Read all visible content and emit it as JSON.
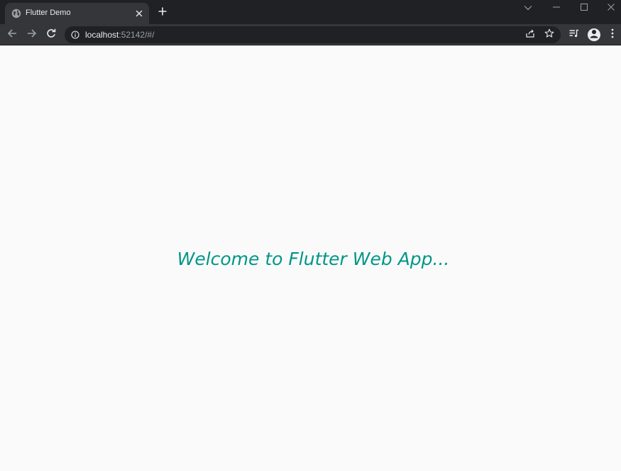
{
  "browser": {
    "tab": {
      "title": "Flutter Demo",
      "favicon_icon": "globe-icon",
      "close_icon": "close-icon"
    },
    "new_tab_icon": "plus-icon",
    "window_controls": {
      "tab_search_icon": "chevron-down-icon",
      "minimize_icon": "minimize-icon",
      "maximize_icon": "maximize-icon",
      "close_icon": "close-icon"
    },
    "toolbar": {
      "back_icon": "arrow-left-icon",
      "forward_icon": "arrow-right-icon",
      "reload_icon": "reload-icon",
      "site_info_icon": "info-icon",
      "url_host": "localhost",
      "url_rest": ":52142/#/",
      "share_icon": "share-icon",
      "bookmark_icon": "star-icon",
      "reading_list_icon": "reading-list-icon",
      "profile_icon": "person-icon",
      "menu_icon": "kebab-menu-icon"
    },
    "colors": {
      "tabstrip": "#202124",
      "toolbar": "#35363a",
      "omnibox": "#202124",
      "icon": "#e8eaed",
      "icon_dim": "#9aa0a6"
    }
  },
  "app": {
    "welcome_text": "Welcome to Flutter Web App...",
    "colors": {
      "background": "#fafafa",
      "accent": "#009688"
    }
  }
}
